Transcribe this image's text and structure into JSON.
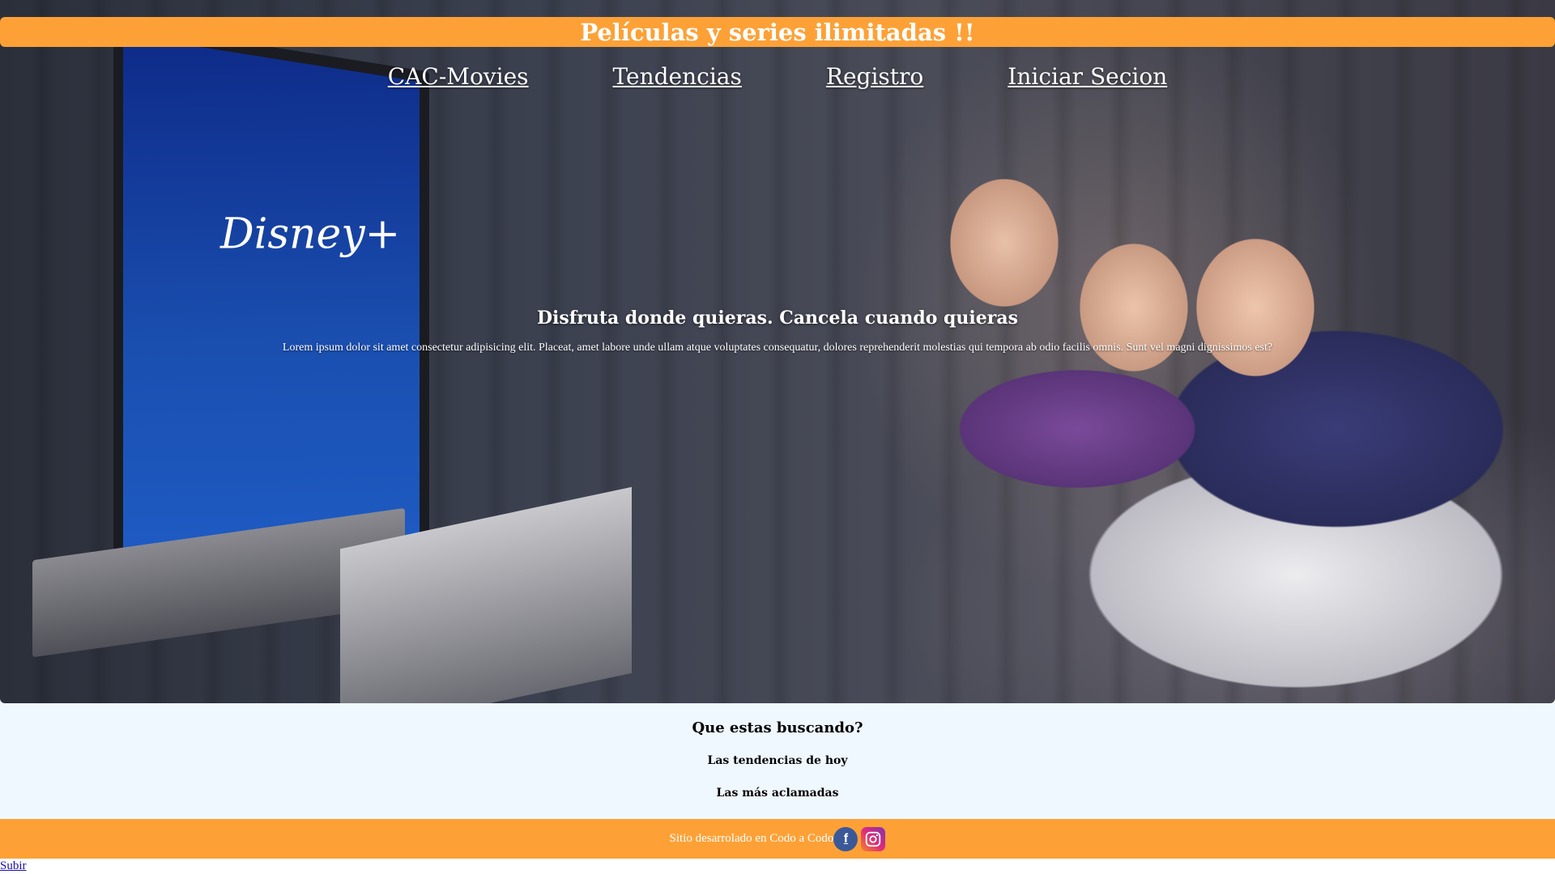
{
  "header": {
    "banner_title": "Películas y series ilimitadas !!"
  },
  "nav": {
    "items": [
      {
        "label": "CAC-Movies"
      },
      {
        "label": "Tendencias"
      },
      {
        "label": "Registro"
      },
      {
        "label": "Iniciar Secion"
      }
    ]
  },
  "hero": {
    "headline": "Disfruta donde quieras. Cancela cuando quieras",
    "body": "Lorem ipsum dolor sit amet consectetur adipisicing elit. Placeat, amet labore unde ullam atque voluptates consequatur, dolores reprehenderit molestias qui tempora ab odio facilis omnis. Sunt vel magni dignissimos est?",
    "tv_logo": "Disney+"
  },
  "search": {
    "title": "Que estas buscando?",
    "options": [
      {
        "label": "Las tendencias de hoy"
      },
      {
        "label": "Las más aclamadas"
      }
    ]
  },
  "footer": {
    "text": "Sitio desarrolado en Codo a Codo",
    "facebook_icon": "f",
    "brand_color": "#fda137"
  },
  "back_to_top": {
    "label": "Subir"
  }
}
